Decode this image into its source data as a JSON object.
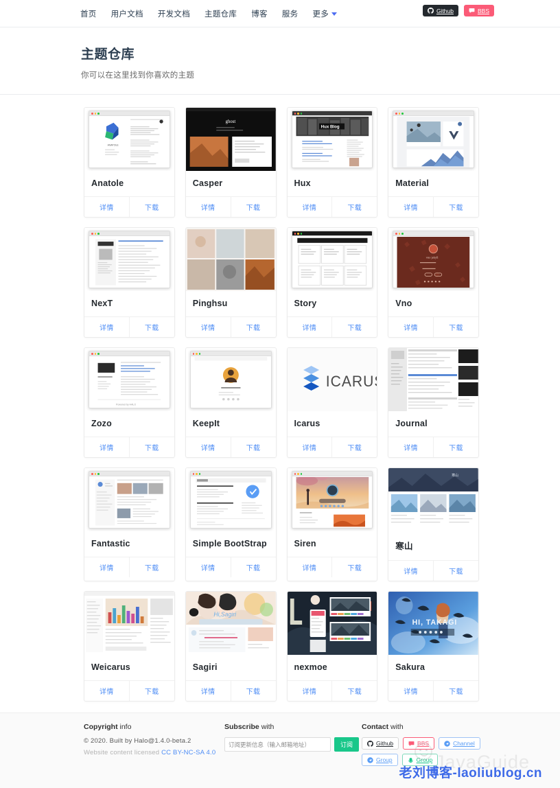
{
  "nav": {
    "links": [
      {
        "label": "首页",
        "name": "nav-home"
      },
      {
        "label": "用户文档",
        "name": "nav-user-docs"
      },
      {
        "label": "开发文档",
        "name": "nav-dev-docs"
      },
      {
        "label": "主题仓库",
        "name": "nav-theme-repo"
      },
      {
        "label": "博客",
        "name": "nav-blog"
      },
      {
        "label": "服务",
        "name": "nav-service"
      },
      {
        "label": "更多",
        "name": "nav-more"
      }
    ],
    "github_label": "Github",
    "bbs_label": "BBS"
  },
  "hero": {
    "title": "主题仓库",
    "subtitle": "你可以在这里找到你喜欢的主题"
  },
  "card_actions": {
    "detail": "详情",
    "download": "下载"
  },
  "themes": [
    {
      "name": "Anatole",
      "thumb": "anatole"
    },
    {
      "name": "Casper",
      "thumb": "casper"
    },
    {
      "name": "Hux",
      "thumb": "hux"
    },
    {
      "name": "Material",
      "thumb": "material"
    },
    {
      "name": "NexT",
      "thumb": "next"
    },
    {
      "name": "Pinghsu",
      "thumb": "pinghsu"
    },
    {
      "name": "Story",
      "thumb": "story"
    },
    {
      "name": "Vno",
      "thumb": "vno"
    },
    {
      "name": "Zozo",
      "thumb": "zozo"
    },
    {
      "name": "KeepIt",
      "thumb": "keepit"
    },
    {
      "name": "Icarus",
      "thumb": "icarus"
    },
    {
      "name": "Journal",
      "thumb": "journal"
    },
    {
      "name": "Fantastic",
      "thumb": "fantastic"
    },
    {
      "name": "Simple BootStrap",
      "thumb": "simplebootstrap"
    },
    {
      "name": "Siren",
      "thumb": "siren"
    },
    {
      "name": "寒山",
      "thumb": "hanshan"
    },
    {
      "name": "Weicarus",
      "thumb": "weicarus"
    },
    {
      "name": "Sagiri",
      "thumb": "sagiri"
    },
    {
      "name": "nexmoe",
      "thumb": "nexmoe"
    },
    {
      "name": "Sakura",
      "thumb": "sakura"
    }
  ],
  "footer": {
    "copyright_head_bold": "Copyright",
    "copyright_head_rest": " info",
    "copyright_line": "© 2020. Built by Halo@1.4.0-beta.2",
    "license_prefix": "Website content licensed ",
    "license_link": "CC BY-NC-SA 4.0",
    "subscribe_head_bold": "Subscribe",
    "subscribe_head_rest": " with",
    "subscribe_placeholder": "订阅更新信息（输入邮箱地址）",
    "subscribe_button": "订阅",
    "contact_head_bold": "Contact",
    "contact_head_rest": " with",
    "contacts": [
      {
        "label": "Github",
        "style": "github"
      },
      {
        "label": "BBS",
        "style": "bbs"
      },
      {
        "label": "Channel",
        "style": "channel"
      },
      {
        "label": "Group",
        "style": "group-blue"
      },
      {
        "label": "Group",
        "style": "group-green"
      }
    ]
  },
  "watermark": {
    "faint": "JavaGuide",
    "blog": "老刘博客-laoliublog.cn"
  },
  "colors": {
    "accent_blue": "#4e8df5",
    "brand_green": "#19c78a",
    "bbs_pink": "#fb5b77",
    "github_dark": "#24292e"
  }
}
